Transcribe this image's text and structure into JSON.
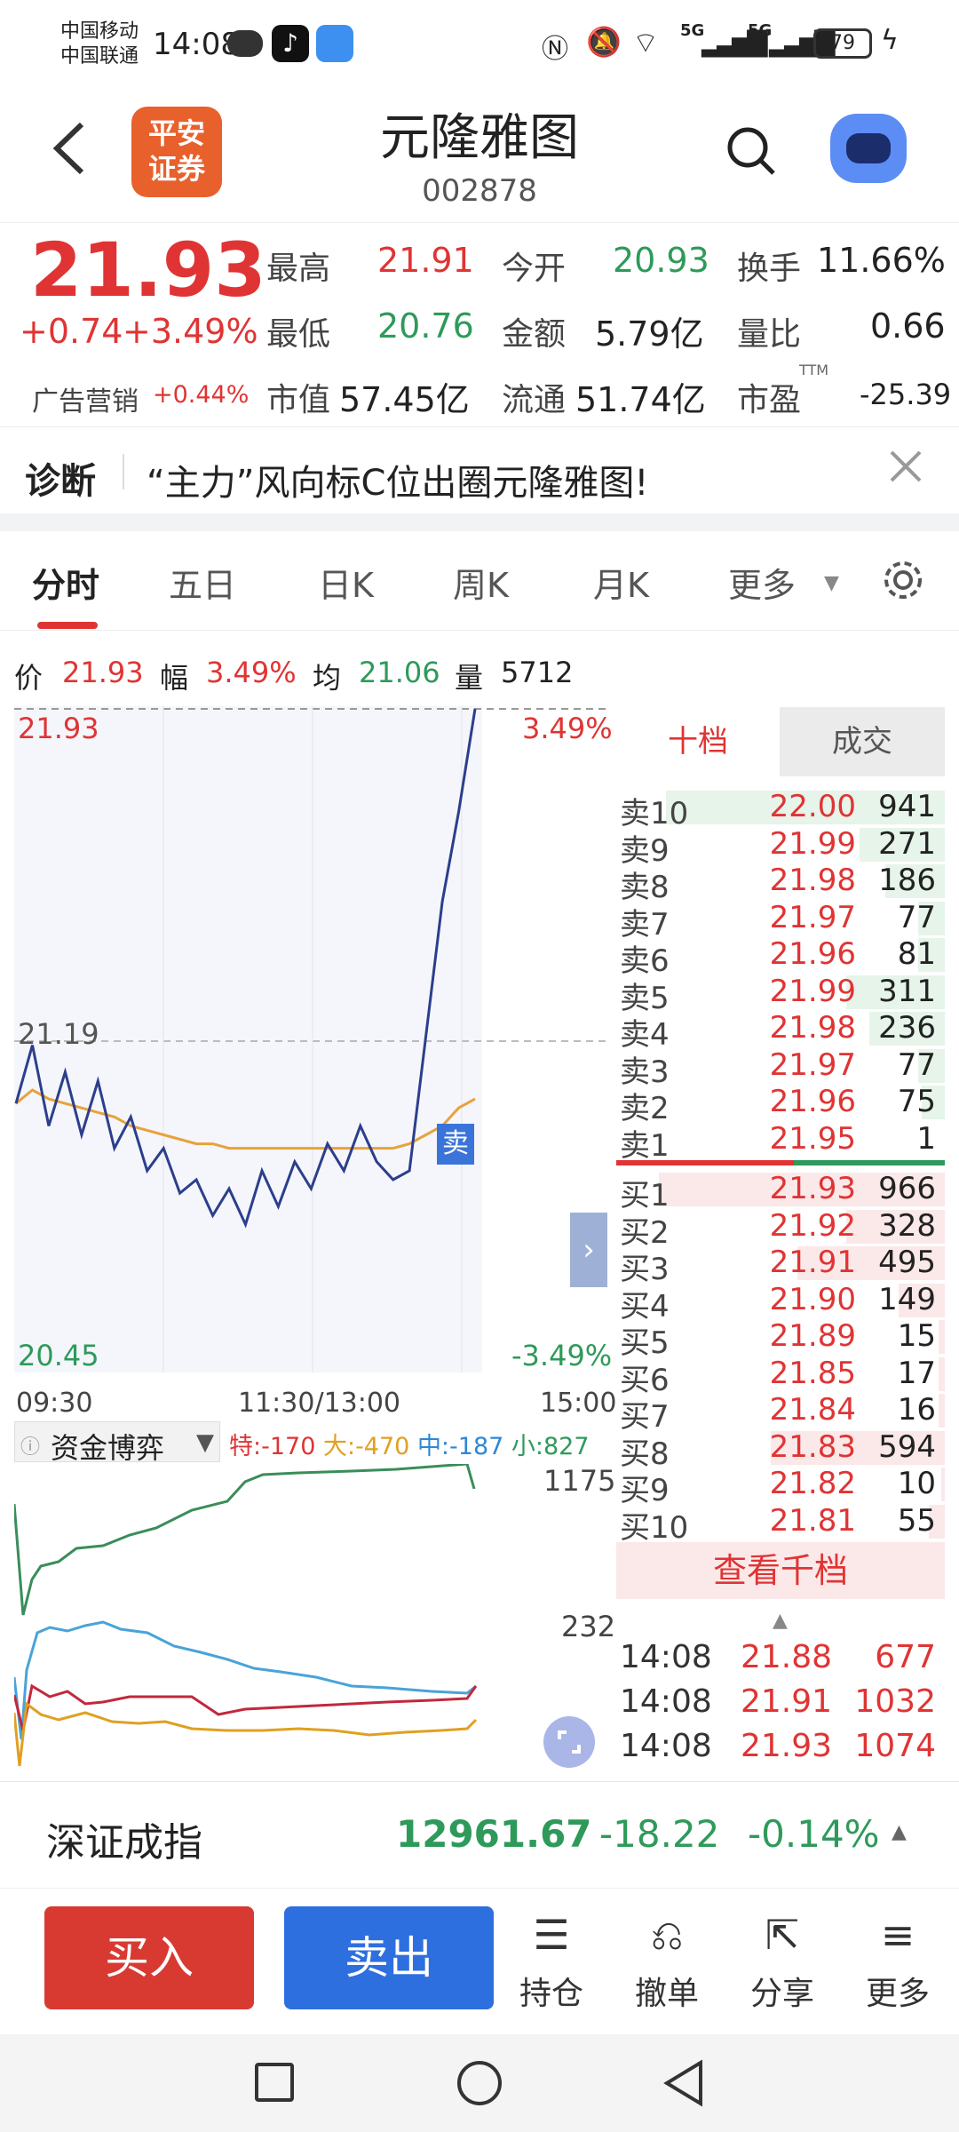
{
  "status": {
    "carrier1": "中国移动",
    "carrier2": "中国联通",
    "time": "14:08",
    "net1": "5G",
    "net2": "5G",
    "battery": "79"
  },
  "header": {
    "title": "元隆雅图",
    "code": "002878",
    "brand_line1": "平安",
    "brand_line2": "证券"
  },
  "quote": {
    "price": "21.93",
    "change": "+0.74",
    "change_pct": "+3.49%",
    "ad_label": "广告营销",
    "ad_pct": "+0.44%",
    "high_label": "最高",
    "high": "21.91",
    "open_label": "今开",
    "open": "20.93",
    "turnover_label": "换手",
    "turnover": "11.66%",
    "low_label": "最低",
    "low": "20.76",
    "amount_label": "金额",
    "amount": "5.79亿",
    "vol_ratio_label": "量比",
    "vol_ratio": "0.66",
    "mcap_label": "市值",
    "mcap": "57.45亿",
    "float_label": "流通",
    "float": "51.74亿",
    "pe_label": "市盈",
    "pe_sup": "TTM",
    "pe": "-25.39"
  },
  "notice": {
    "label": "诊断",
    "text": "“主力”风向标C位出圈元隆雅图!"
  },
  "tabs": {
    "t1": "分时",
    "t2": "五日",
    "t3": "日K",
    "t4": "周K",
    "t5": "月K",
    "t6": "更多"
  },
  "info": {
    "price_label": "价",
    "price": "21.93",
    "amp_label": "幅",
    "amp": "3.49%",
    "avg_label": "均",
    "avg": "21.06",
    "vol_label": "量",
    "vol": "5712"
  },
  "chart": {
    "top_price": "21.93",
    "top_pct": "3.49%",
    "mid_price": "21.19",
    "low_price": "20.45",
    "low_pct": "-3.49%",
    "t_open": "09:30",
    "t_mid": "11:30/13:00",
    "t_close": "15:00",
    "sell_marker": "卖",
    "vol_top": "1175",
    "vol_mid": "232"
  },
  "fund": {
    "label": "资金博弈",
    "special": "特:-170",
    "big": "大:-470",
    "mid": "中:-187",
    "small": "小:827"
  },
  "orderbook": {
    "tab1": "十档",
    "tab2": "成交",
    "more": "查看千档",
    "sells": [
      {
        "l": "卖10",
        "p": "22.00",
        "q": "941",
        "w": 0.85
      },
      {
        "l": "卖9",
        "p": "21.99",
        "q": "271",
        "w": 0.26
      },
      {
        "l": "卖8",
        "p": "21.98",
        "q": "186",
        "w": 0.18
      },
      {
        "l": "卖7",
        "p": "21.97",
        "q": "77",
        "w": 0.08
      },
      {
        "l": "卖6",
        "p": "21.96",
        "q": "81",
        "w": 0.08
      },
      {
        "l": "卖5",
        "p": "21.99",
        "q": "311",
        "w": 0.3
      },
      {
        "l": "卖4",
        "p": "21.98",
        "q": "236",
        "w": 0.23
      },
      {
        "l": "卖3",
        "p": "21.97",
        "q": "77",
        "w": 0.08
      },
      {
        "l": "卖2",
        "p": "21.96",
        "q": "75",
        "w": 0.07
      },
      {
        "l": "卖1",
        "p": "21.95",
        "q": "1",
        "w": 0
      }
    ],
    "buys": [
      {
        "l": "买1",
        "p": "21.93",
        "q": "966",
        "w": 0.87
      },
      {
        "l": "买2",
        "p": "21.92",
        "q": "328",
        "w": 0.3
      },
      {
        "l": "买3",
        "p": "21.91",
        "q": "495",
        "w": 0.45
      },
      {
        "l": "买4",
        "p": "21.90",
        "q": "149",
        "w": 0.14
      },
      {
        "l": "买5",
        "p": "21.89",
        "q": "15",
        "w": 0.02
      },
      {
        "l": "买6",
        "p": "21.85",
        "q": "17",
        "w": 0.02
      },
      {
        "l": "买7",
        "p": "21.84",
        "q": "16",
        "w": 0.02
      },
      {
        "l": "买8",
        "p": "21.83",
        "q": "594",
        "w": 0.53
      },
      {
        "l": "买9",
        "p": "21.82",
        "q": "10",
        "w": 0.01
      },
      {
        "l": "买10",
        "p": "21.81",
        "q": "55",
        "w": 0.05
      }
    ],
    "ticks": [
      {
        "t": "14:08",
        "p": "21.88",
        "q": "677"
      },
      {
        "t": "14:08",
        "p": "21.91",
        "q": "1032"
      },
      {
        "t": "14:08",
        "p": "21.93",
        "q": "1074"
      }
    ]
  },
  "index": {
    "name": "深证成指",
    "value": "12961.67",
    "change": "-18.22",
    "pct": "-0.14%"
  },
  "bottom": {
    "buy": "买入",
    "sell": "卖出",
    "hold": "持仓",
    "cancel": "撤单",
    "share": "分享",
    "more": "更多"
  },
  "colors": {
    "up": "#e03434",
    "down": "#2e9a5a",
    "buy_btn": "#d83a32",
    "sell_btn": "#2e6fe0",
    "price_line": "#2c3e8c",
    "avg_line": "#e8a23a"
  },
  "chart_data": {
    "type": "line",
    "x_range": [
      "09:30",
      "15:00"
    ],
    "ylim": [
      20.45,
      21.93
    ],
    "ref_price": 21.19,
    "series": [
      {
        "values": [
          21.05,
          21.18,
          21.0,
          21.12,
          20.98,
          21.1,
          20.95,
          21.02,
          20.9,
          20.95,
          20.85,
          20.88,
          20.8,
          20.86,
          20.78,
          20.9,
          20.82,
          20.92,
          20.86,
          20.96,
          20.9,
          21.0,
          20.92,
          20.88,
          20.9,
          21.2,
          21.5,
          21.7,
          21.93
        ]
      },
      {
        "values": [
          21.05,
          21.08,
          21.06,
          21.05,
          21.04,
          21.03,
          21.02,
          21.0,
          20.99,
          20.98,
          20.97,
          20.96,
          20.96,
          20.95,
          20.95,
          20.95,
          20.95,
          20.95,
          20.95,
          20.95,
          20.95,
          20.95,
          20.95,
          20.95,
          20.96,
          20.98,
          21.0,
          21.04,
          21.06
        ]
      }
    ]
  }
}
